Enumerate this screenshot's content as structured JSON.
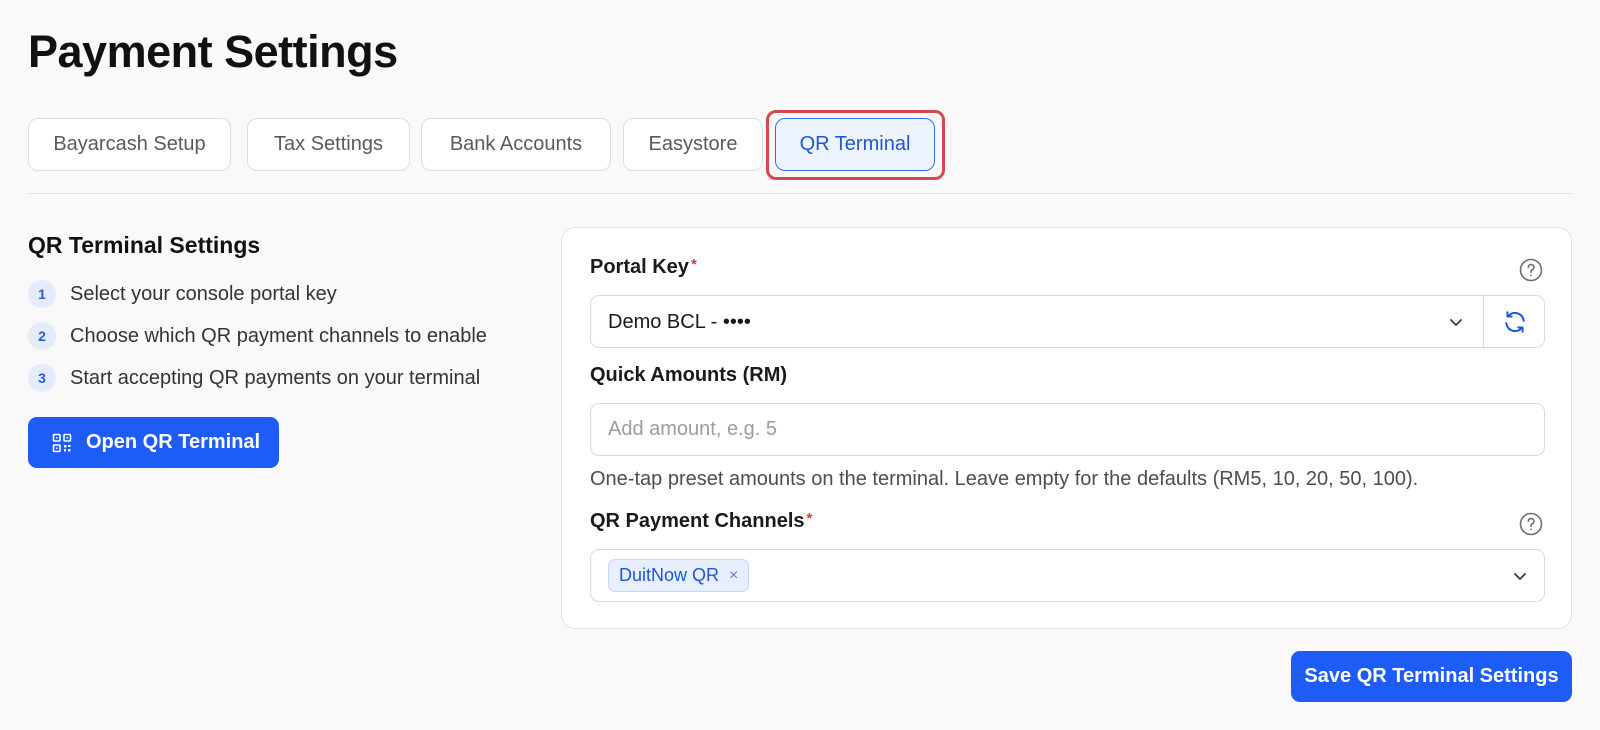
{
  "page": {
    "title": "Payment Settings"
  },
  "tabs": [
    {
      "label": "Bayarcash Setup",
      "active": false
    },
    {
      "label": "Tax Settings",
      "active": false
    },
    {
      "label": "Bank Accounts",
      "active": false
    },
    {
      "label": "Easystore",
      "active": false
    },
    {
      "label": "QR Terminal",
      "active": true
    }
  ],
  "intro": {
    "heading": "QR Terminal Settings",
    "steps": [
      {
        "number": "1",
        "text": "Select your console portal key"
      },
      {
        "number": "2",
        "text": "Choose which QR payment channels to enable"
      },
      {
        "number": "3",
        "text": "Start accepting QR payments on your terminal"
      }
    ],
    "open_button": {
      "label": "Open QR Terminal",
      "icon": "qr-code-icon"
    }
  },
  "form": {
    "portal_key": {
      "label": "Portal Key",
      "required_mark": "*",
      "value": "Demo BCL - ••••",
      "refresh_icon": "refresh-icon",
      "help_icon": "help-circle-icon"
    },
    "quick_amounts": {
      "label": "Quick Amounts (RM)",
      "value": "",
      "placeholder": "Add amount, e.g. 5",
      "helper": "One-tap preset amounts on the terminal. Leave empty for the defaults (RM5, 10, 20, 50, 100)."
    },
    "qr_channels": {
      "label": "QR Payment Channels",
      "required_mark": "*",
      "selected": [
        {
          "label": "DuitNow QR",
          "remove": "×"
        }
      ],
      "help_icon": "help-circle-icon"
    }
  },
  "save_button": {
    "label": "Save QR Terminal Settings"
  },
  "colors": {
    "accent": "#1d5cf5",
    "active_tab_bg": "#eef4ff",
    "highlight_border": "#d9474c",
    "required": "#d9363e"
  }
}
